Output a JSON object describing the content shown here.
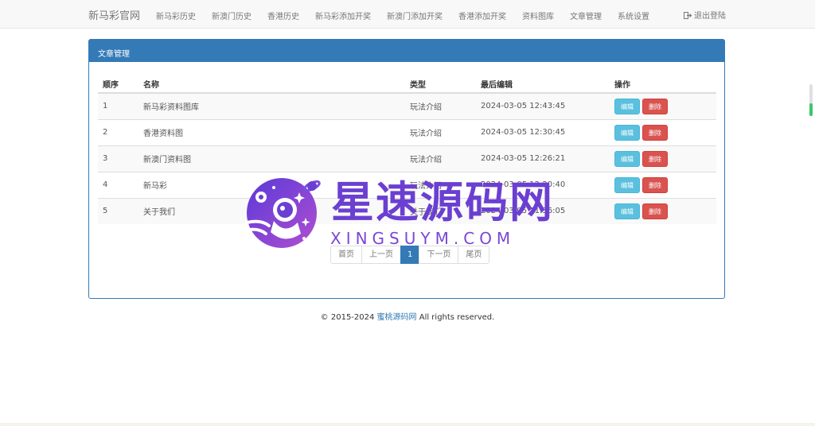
{
  "navbar": {
    "brand": "新马彩官网",
    "items": [
      {
        "label": "新马彩历史"
      },
      {
        "label": "新澳门历史"
      },
      {
        "label": "香港历史"
      },
      {
        "label": "新马彩添加开奖"
      },
      {
        "label": "新澳门添加开奖"
      },
      {
        "label": "香港添加开奖"
      },
      {
        "label": "资料图库"
      },
      {
        "label": "文章管理"
      },
      {
        "label": "系统设置"
      }
    ],
    "logout": "退出登陆",
    "logout_icon": "logout-icon"
  },
  "panel": {
    "title": "文章管理",
    "columns": {
      "index": "顺序",
      "name": "名称",
      "type": "类型",
      "updated": "最后编辑",
      "actions": "操作"
    },
    "rows": [
      {
        "index": "1",
        "name": "新马彩资料图库",
        "type": "玩法介绍",
        "updated": "2024-03-05 12:43:45",
        "edit": "编辑",
        "delete": "删除"
      },
      {
        "index": "2",
        "name": "香港资料图",
        "type": "玩法介绍",
        "updated": "2024-03-05 12:30:45",
        "edit": "编辑",
        "delete": "删除"
      },
      {
        "index": "3",
        "name": "新澳门资料图",
        "type": "玩法介绍",
        "updated": "2024-03-05 12:26:21",
        "edit": "编辑",
        "delete": "删除"
      },
      {
        "index": "4",
        "name": "新马彩",
        "type": "玩法介绍",
        "updated": "2024-03-05 12:20:40",
        "edit": "编辑",
        "delete": "删除"
      },
      {
        "index": "5",
        "name": "关于我们",
        "type": "关于我们",
        "updated": "2024-03-05 11:56:05",
        "edit": "编辑",
        "delete": "删除"
      }
    ]
  },
  "pagination": {
    "first": "首页",
    "prev": "上一页",
    "current": "1",
    "next": "下一页",
    "last": "尾页"
  },
  "footer": {
    "prefix": "© 2015-2024 ",
    "link": "蜜桃源码网",
    "suffix": " All rights reserved."
  },
  "watermark": {
    "title": "星速源码网",
    "subtitle": "XINGSUYM.COM",
    "logo_icon": "astronaut-planet-logo"
  },
  "colors": {
    "primary": "#337ab7",
    "edit_button": "#5bc0de",
    "delete_button": "#d9534f",
    "watermark": "#6b3fd1"
  }
}
